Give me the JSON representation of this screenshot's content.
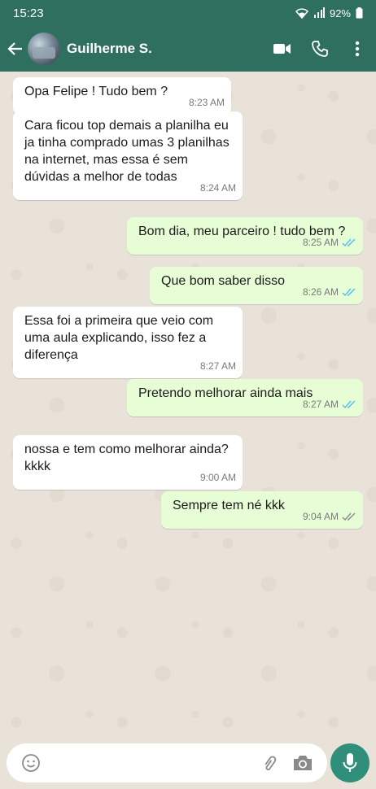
{
  "status_bar": {
    "time": "15:23",
    "battery": "92%"
  },
  "header": {
    "contact_name": "Guilherme S."
  },
  "messages": [
    {
      "dir": "in",
      "text": "Opa Felipe ! Tudo bem ?",
      "time": "8:23 AM"
    },
    {
      "dir": "in",
      "text": "Cara ficou top demais a planilha eu ja tinha comprado umas 3 planilhas na internet, mas essa é sem dúvidas a melhor de todas",
      "time": "8:24 AM"
    },
    {
      "dir": "out",
      "text": "Bom dia, meu parceiro ! tudo bem ?",
      "time": "8:25 AM",
      "status": "read"
    },
    {
      "dir": "out",
      "text": "Que bom saber disso",
      "time": "8:26 AM",
      "status": "read"
    },
    {
      "dir": "in",
      "text": "Essa foi a primeira que veio com uma aula explicando, isso fez a diferença",
      "time": "8:27 AM"
    },
    {
      "dir": "out",
      "text": "Pretendo melhorar ainda mais",
      "time": "8:27 AM",
      "status": "read"
    },
    {
      "dir": "in",
      "text": "nossa e tem como melhorar ainda? kkkk",
      "time": "9:00 AM"
    },
    {
      "dir": "out",
      "text": "Sempre tem né kkk",
      "time": "9:04 AM",
      "status": "delivered"
    }
  ],
  "input": {
    "value": "",
    "placeholder": ""
  },
  "colors": {
    "header": "#2f6f5f",
    "outgoing_bubble": "#e7fdd6",
    "incoming_bubble": "#ffffff",
    "read_ticks": "#53bdeb",
    "delivered_ticks": "#8a8a8a",
    "mic_button": "#2f8f7a"
  }
}
